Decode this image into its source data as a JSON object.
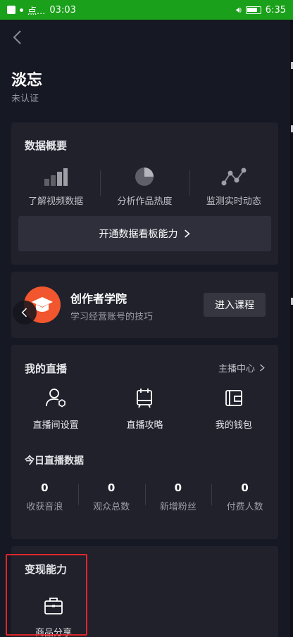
{
  "status_bar": {
    "app_label": "点...",
    "time_left": "03:03",
    "time_right": "6:35"
  },
  "header": {
    "title": "淡忘",
    "subtitle": "未认证"
  },
  "data_overview": {
    "title": "数据概要",
    "tools": [
      {
        "label": "了解视频数据",
        "icon": "bar-chart-icon"
      },
      {
        "label": "分析作品热度",
        "icon": "pie-chart-icon"
      },
      {
        "label": "监测实时动态",
        "icon": "line-trend-icon"
      }
    ],
    "open_button": "开通数据看板能力"
  },
  "academy": {
    "name": "创作者学院",
    "desc": "学习经营账号的技巧",
    "enter_button": "进入课程"
  },
  "live": {
    "title": "我的直播",
    "center_link": "主播中心",
    "items": [
      {
        "label": "直播间设置",
        "icon": "user-settings-icon"
      },
      {
        "label": "直播攻略",
        "icon": "guide-icon"
      },
      {
        "label": "我的钱包",
        "icon": "wallet-icon"
      }
    ],
    "today_title": "今日直播数据",
    "stats": [
      {
        "value": "0",
        "label": "收获音浪"
      },
      {
        "value": "0",
        "label": "观众总数"
      },
      {
        "value": "0",
        "label": "新增粉丝"
      },
      {
        "value": "0",
        "label": "付费人数"
      }
    ]
  },
  "monetize": {
    "title": "变现能力",
    "item_label": "商品分享"
  },
  "colors": {
    "background": "#161823",
    "card": "#20212b",
    "accent": "#f2562e",
    "highlight": "#e0262b",
    "statusbar": "#1aa01a"
  }
}
